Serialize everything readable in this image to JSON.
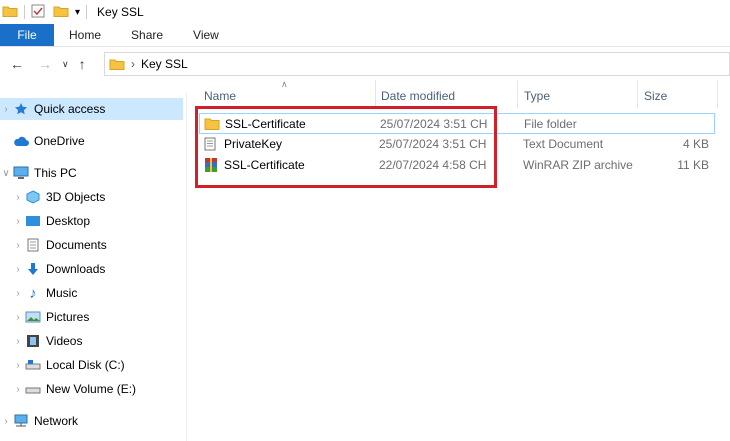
{
  "window": {
    "title": "Key SSL"
  },
  "ribbon": {
    "file": "File",
    "tabs": [
      "Home",
      "Share",
      "View"
    ]
  },
  "address": {
    "path": "Key SSL",
    "separator": "›"
  },
  "sidebar": {
    "quick_access": "Quick access",
    "onedrive": "OneDrive",
    "this_pc": "This PC",
    "items": [
      "3D Objects",
      "Desktop",
      "Documents",
      "Downloads",
      "Music",
      "Pictures",
      "Videos",
      "Local Disk (C:)",
      "New Volume (E:)"
    ],
    "network": "Network"
  },
  "columns": {
    "name": "Name",
    "date": "Date modified",
    "type": "Type",
    "size": "Size"
  },
  "files": [
    {
      "name": "SSL-Certificate",
      "date": "25/07/2024 3:51 CH",
      "type": "File folder",
      "size": "",
      "icon": "folder-icon"
    },
    {
      "name": "PrivateKey",
      "date": "25/07/2024 3:51 CH",
      "type": "Text Document",
      "size": "4 KB",
      "icon": "text-file-icon"
    },
    {
      "name": "SSL-Certificate",
      "date": "22/07/2024 4:58 CH",
      "type": "WinRAR ZIP archive",
      "size": "11 KB",
      "icon": "winrar-icon"
    }
  ],
  "colors": {
    "accent": "#1a6fc9",
    "selection": "#cce8ff",
    "highlight_box": "#d0202a"
  }
}
